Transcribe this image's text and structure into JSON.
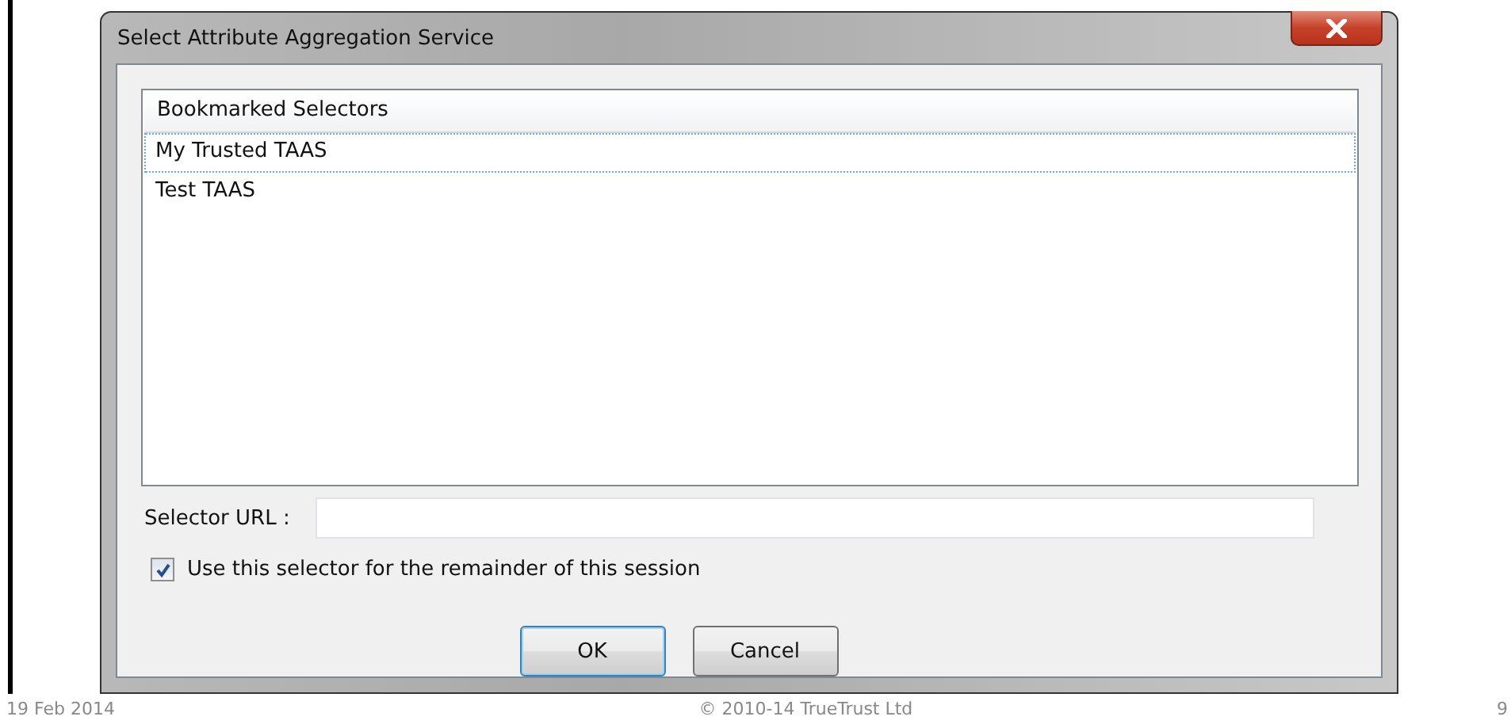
{
  "window": {
    "title": "Select Attribute Aggregation Service"
  },
  "list": {
    "header": "Bookmarked Selectors",
    "items": [
      {
        "label": "My Trusted TAAS",
        "selected": true
      },
      {
        "label": "Test TAAS",
        "selected": false
      }
    ]
  },
  "selector_url": {
    "label": "Selector URL :"
  },
  "checkbox": {
    "label": "Use this selector for the remainder of this session",
    "checked": true
  },
  "buttons": [
    {
      "label": "OK",
      "default": true
    },
    {
      "label": "Cancel",
      "default": false
    }
  ],
  "footer": {
    "date": "19 Feb 2014",
    "copyright": "© 2010-14 TrueTrust Ltd",
    "page": "9"
  }
}
